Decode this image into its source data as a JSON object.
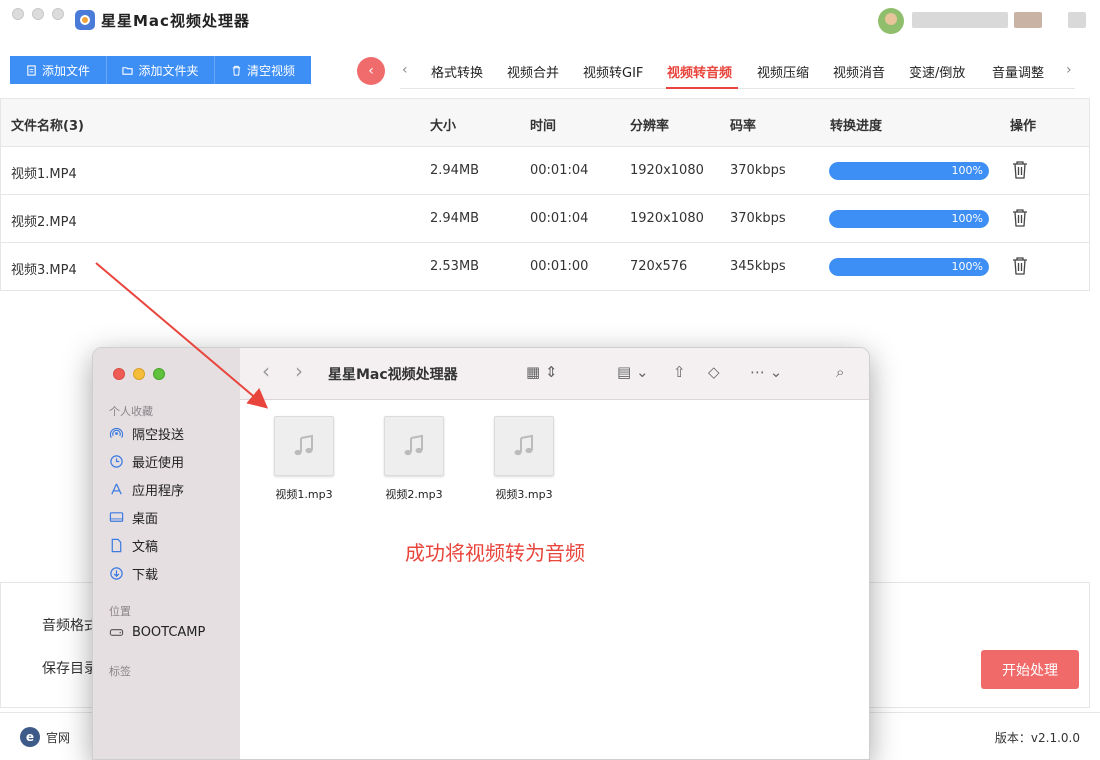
{
  "app": {
    "title": "星星Mac视频处理器",
    "toolbar": {
      "add_file": "添加文件",
      "add_folder": "添加文件夹",
      "clear_video": "清空视频"
    },
    "tabs": [
      "格式转换",
      "视频合并",
      "视频转GIF",
      "视频转音频",
      "视频压缩",
      "视频消音",
      "变速/倒放",
      "音量调整"
    ],
    "active_tab": "视频转音频",
    "table": {
      "headers": {
        "name": "文件名称(3)",
        "size": "大小",
        "time": "时间",
        "resolution": "分辨率",
        "bitrate": "码率",
        "progress": "转换进度",
        "action": "操作"
      },
      "rows": [
        {
          "name": "视频1.MP4",
          "size": "2.94MB",
          "time": "00:01:04",
          "resolution": "1920x1080",
          "bitrate": "370kbps",
          "progress": 100,
          "progress_text": "100%"
        },
        {
          "name": "视频2.MP4",
          "size": "2.94MB",
          "time": "00:01:04",
          "resolution": "1920x1080",
          "bitrate": "370kbps",
          "progress": 100,
          "progress_text": "100%"
        },
        {
          "name": "视频3.MP4",
          "size": "2.53MB",
          "time": "00:01:00",
          "resolution": "720x576",
          "bitrate": "345kbps",
          "progress": 100,
          "progress_text": "100%"
        }
      ]
    },
    "settings": {
      "audio_format_label": "音频格式",
      "save_dir_label": "保存目录"
    },
    "start_button": "开始处理",
    "footer": {
      "official": "官网",
      "version": "版本：v2.1.0.0"
    },
    "colors": {
      "accent": "#3d8ef5",
      "active_tab": "#e8453c",
      "start": "#f06a6a"
    }
  },
  "finder": {
    "title": "星星Mac视频处理器",
    "sidebar": {
      "favorites_header": "个人收藏",
      "favorites": [
        {
          "label": "隔空投送",
          "icon": "airdrop-icon"
        },
        {
          "label": "最近使用",
          "icon": "clock-icon"
        },
        {
          "label": "应用程序",
          "icon": "applications-icon"
        },
        {
          "label": "桌面",
          "icon": "desktop-icon"
        },
        {
          "label": "文稿",
          "icon": "document-icon"
        },
        {
          "label": "下载",
          "icon": "download-icon"
        }
      ],
      "locations_header": "位置",
      "locations": [
        {
          "label": "BOOTCAMP",
          "icon": "drive-icon"
        }
      ],
      "tags_header": "标签"
    },
    "files": [
      "视频1.mp3",
      "视频2.mp3",
      "视频3.mp3"
    ]
  },
  "annotation": "成功将视频转为音频"
}
